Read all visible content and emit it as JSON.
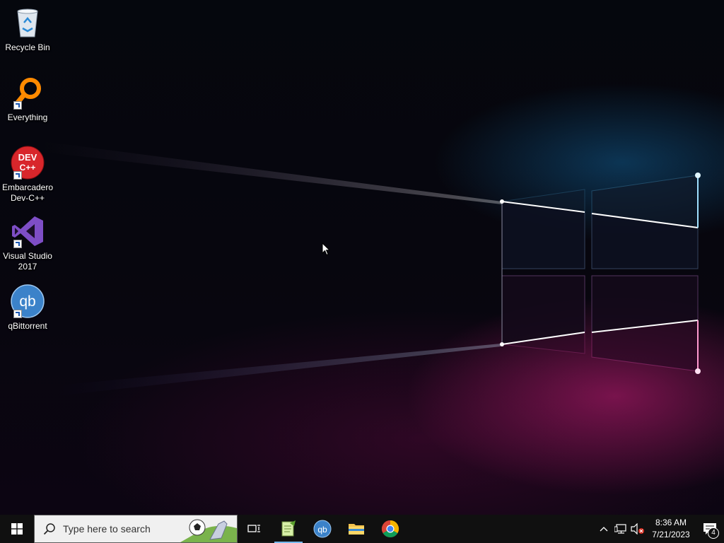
{
  "desktop": {
    "icons": [
      {
        "label": "Recycle Bin",
        "icon": "recycle-bin-icon"
      },
      {
        "label": "Everything",
        "icon": "everything-search-icon"
      },
      {
        "label": "Embarcadero\nDev-C++",
        "icon": "dev-cpp-icon"
      },
      {
        "label": "Visual Studio\n2017",
        "icon": "visual-studio-icon"
      },
      {
        "label": "qBittorrent",
        "icon": "qbittorrent-icon"
      }
    ]
  },
  "taskbar": {
    "search_placeholder": "Type here to search",
    "apps": [
      {
        "name": "Task View",
        "icon": "task-view-icon"
      },
      {
        "name": "Notepad++",
        "icon": "notepad-plus-plus-icon",
        "active": true
      },
      {
        "name": "qBittorrent",
        "icon": "qbittorrent-icon"
      },
      {
        "name": "File Explorer",
        "icon": "folder-icon"
      },
      {
        "name": "Google Chrome",
        "icon": "chrome-icon"
      }
    ],
    "clock": {
      "time": "8:36 AM",
      "date": "7/21/2023"
    },
    "notifications_count": "4"
  },
  "colors": {
    "taskbar_bg": "#101010",
    "accent": "#76b9ed"
  }
}
